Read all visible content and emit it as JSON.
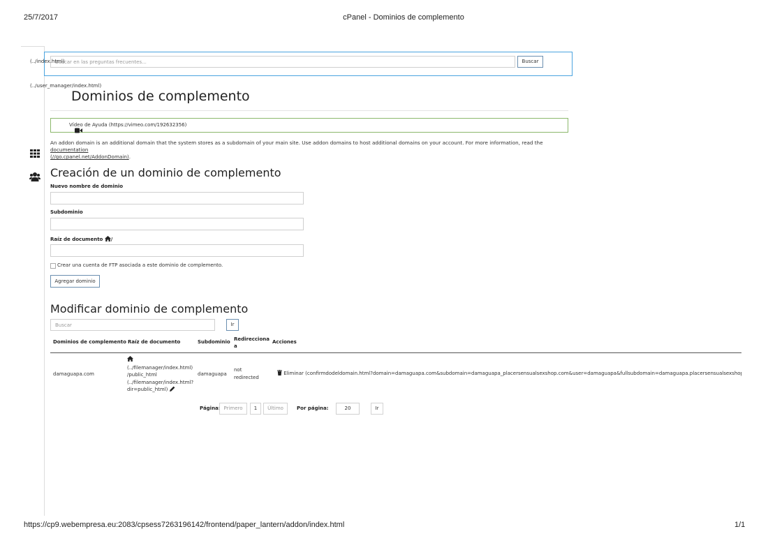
{
  "print_header": {
    "date": "25/7/2017",
    "title": "cPanel - Dominios de complemento"
  },
  "print_footer": {
    "url": "https://cp9.webempresa.eu:2083/cpsess7263196142/frontend/paper_lantern/addon/index.html",
    "page": "1/1"
  },
  "nav_links": {
    "home": "(../index.html)",
    "user_manager": "(../user_manager/index.html)"
  },
  "faq_search": {
    "placeholder": "Buscar en las preguntas frecuentes...",
    "button": "Buscar"
  },
  "page_title": "Dominios de complemento",
  "video": {
    "label": "Vídeo de Ayuda (https://vimeo.com/192632356)"
  },
  "description": {
    "text": "An addon domain is an additional domain that the system stores as a subdomain of your main site. Use addon domains to host additional domains on your account. For more information, read the",
    "link": "documentation",
    "link_url": "(//go.cpanel.net/AddonDomain)",
    "end": "."
  },
  "create": {
    "heading": "Creación de un dominio de complemento",
    "domain_label": "Nuevo nombre de dominio",
    "subdomain_label": "Subdominio",
    "docroot_label": "Raíz de documento",
    "docroot_suffix": "/",
    "ftp_checkbox_label": "Crear una cuenta de FTP asociada a este dominio de complemento.",
    "submit_button": "Agregar dominio"
  },
  "modify": {
    "heading": "Modificar dominio de complemento",
    "search_placeholder": "Buscar",
    "go_button": "Ir",
    "columns": [
      "Dominios de complemento",
      "Raíz de documento",
      "Subdominio",
      "Redirecciona a",
      "Acciones"
    ],
    "rows": [
      {
        "domain": "damaguapa.com",
        "docroot_lines": [
          "(../filemanager/index.html)",
          "/public_html",
          "(../filemanager/index.html?",
          "dir=public_html)"
        ],
        "subdomain": "damaguapa",
        "redirect": "not redirected",
        "action": "Eliminar (confirmdodeldomain.html?domain=damaguapa.com&subdomain=damaguapa_placersensualsexshop.com&user=damaguapa&fullsubdomain=damaguapa.placersensualsexshop.com)"
      }
    ],
    "pagination": {
      "label": "Página:",
      "first": "Primero",
      "current": "1",
      "last": "Último",
      "per_page_label": "Por página:",
      "per_page_value": "20",
      "go": "Ir"
    }
  },
  "colors": {
    "accent_blue": "#4aa3df",
    "video_border": "#8bb86b"
  },
  "icons": [
    "video-camera-icon",
    "apps-grid-icon",
    "users-icon",
    "home-icon",
    "pencil-icon",
    "trash-icon"
  ]
}
